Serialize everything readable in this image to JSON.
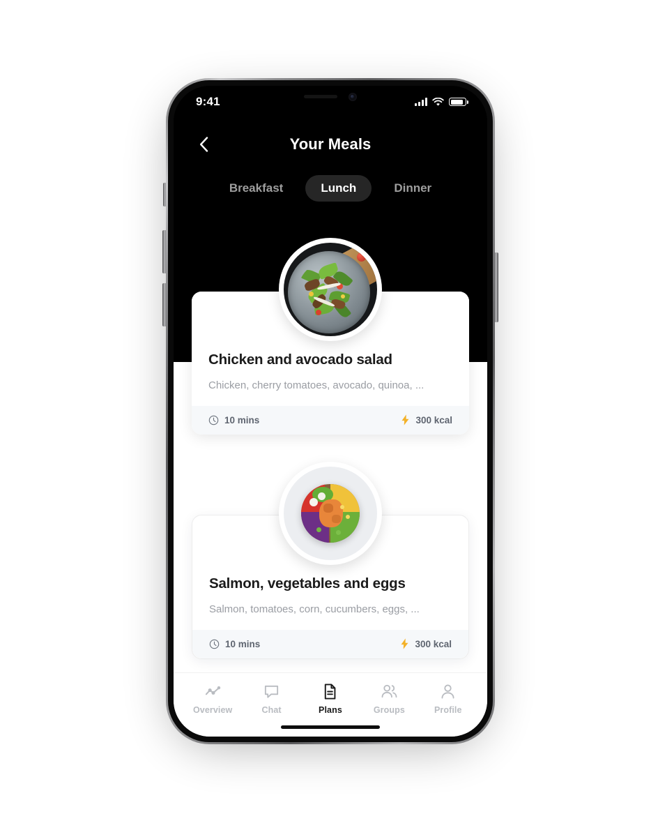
{
  "status_bar": {
    "time": "9:41",
    "icons": [
      "signal-icon",
      "wifi-icon",
      "battery-icon"
    ],
    "battery_level": 85
  },
  "header": {
    "back_icon": "chevron-left-icon",
    "title": "Your Meals",
    "background_color": "#000000"
  },
  "meal_tabs": {
    "active": "Lunch",
    "items": [
      {
        "label": "Breakfast",
        "active": false
      },
      {
        "label": "Lunch",
        "active": true
      },
      {
        "label": "Dinner",
        "active": false
      }
    ]
  },
  "meals": [
    {
      "title": "Chicken and avocado salad",
      "ingredients": "Chicken, cherry tomatoes, avocado, quinoa, ...",
      "time_icon": "clock-icon",
      "time": "10 mins",
      "energy_icon": "bolt-icon",
      "energy": "300 kcal",
      "image_alt": "chicken-avocado-salad-bowl"
    },
    {
      "title": "Salmon, vegetables and eggs",
      "ingredients": "Salmon, tomatoes, corn, cucumbers, eggs, ...",
      "time_icon": "clock-icon",
      "time": "10 mins",
      "energy_icon": "bolt-icon",
      "energy": "300 kcal",
      "image_alt": "salmon-vegetable-egg-bowl"
    }
  ],
  "bottom_nav": {
    "active": "Plans",
    "items": [
      {
        "label": "Overview",
        "icon": "analytics-icon",
        "active": false
      },
      {
        "label": "Chat",
        "icon": "chat-bubble-icon",
        "active": false
      },
      {
        "label": "Plans",
        "icon": "document-icon",
        "active": true
      },
      {
        "label": "Groups",
        "icon": "people-icon",
        "active": false
      },
      {
        "label": "Profile",
        "icon": "person-icon",
        "active": false
      }
    ]
  },
  "colors": {
    "accent_energy": "#f3b128",
    "header_bg": "#000000",
    "meta_bg": "#f6f8fa",
    "active_tab_pill": "#262626",
    "inactive_text": "#9e9e9e",
    "muted_text": "#9a9da3"
  }
}
